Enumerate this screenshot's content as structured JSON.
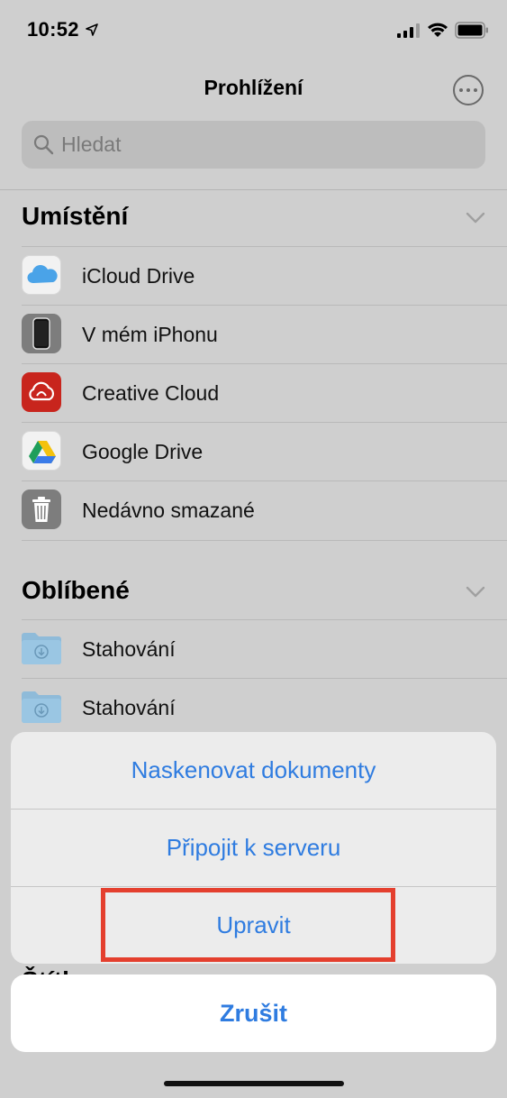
{
  "status": {
    "time": "10:52"
  },
  "nav": {
    "title": "Prohlížení"
  },
  "search": {
    "placeholder": "Hledat"
  },
  "locations": {
    "header": "Umístění",
    "items": [
      {
        "label": "iCloud Drive",
        "icon": "icloud-icon"
      },
      {
        "label": "V mém iPhonu",
        "icon": "iphone-icon"
      },
      {
        "label": "Creative Cloud",
        "icon": "creative-cloud-icon"
      },
      {
        "label": "Google Drive",
        "icon": "google-drive-icon"
      },
      {
        "label": "Nedávno smazané",
        "icon": "trash-icon"
      }
    ]
  },
  "favorites": {
    "header": "Oblíbené",
    "items": [
      {
        "label": "Stahování",
        "icon": "downloads-folder-icon"
      },
      {
        "label": "Stahování",
        "icon": "downloads-folder-icon"
      }
    ]
  },
  "tags": {
    "header": "Štítky"
  },
  "action_sheet": {
    "items": [
      "Naskenovat dokumenty",
      "Připojit k serveru",
      "Upravit"
    ],
    "cancel": "Zrušit"
  },
  "colors": {
    "accent": "#2f7ce0",
    "highlight": "#e43f2e"
  }
}
